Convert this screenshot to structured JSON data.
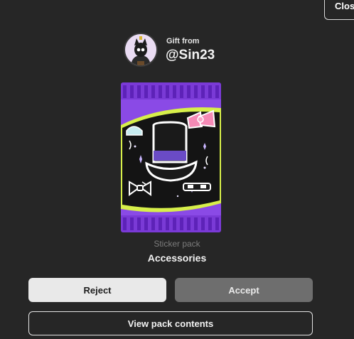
{
  "header": {
    "close_label": "Clos"
  },
  "gift": {
    "from_label": "Gift from",
    "username": "@Sin23"
  },
  "pack": {
    "type_label": "Sticker pack",
    "name": "Accessories"
  },
  "actions": {
    "reject_label": "Reject",
    "accept_label": "Accept",
    "view_label": "View pack contents"
  },
  "colors": {
    "background": "#262626",
    "pack_purple": "#7a3ad6",
    "pack_inner": "#141414",
    "accent_green": "#d7ef4a",
    "reject_bg": "#e9e9e9",
    "accept_bg": "#6e6e6e"
  },
  "icons": [
    "top-hat-sticker",
    "pink-bow-sticker",
    "bow-tie-sticker",
    "sunglasses-sticker",
    "blue-cap-sticker"
  ]
}
